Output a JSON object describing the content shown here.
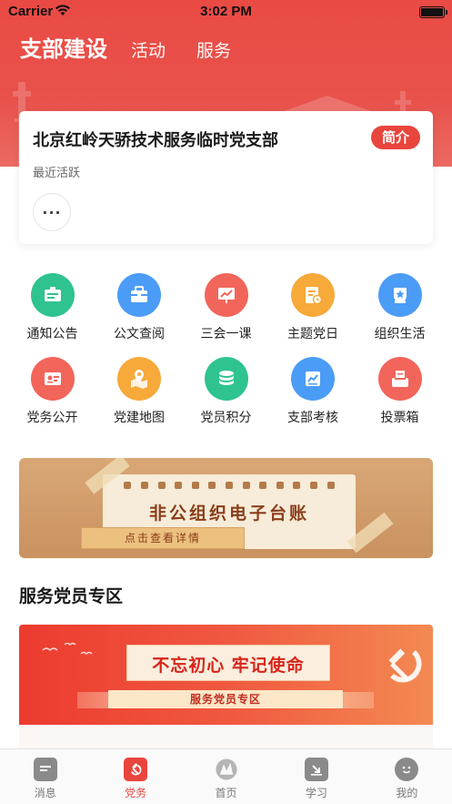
{
  "status_bar": {
    "carrier": "Carrier",
    "time": "3:02 PM"
  },
  "header": {
    "tabs": [
      {
        "label": "支部建设",
        "active": true
      },
      {
        "label": "活动",
        "active": false
      },
      {
        "label": "服务",
        "active": false
      }
    ]
  },
  "branch_card": {
    "name": "北京红岭天骄技术服务临时党支部",
    "intro_label": "简介",
    "recent_label": "最近活跃",
    "more_label": "···"
  },
  "grid": {
    "items": [
      {
        "label": "通知公告",
        "icon": "notice-board-icon",
        "color": "#2fc38f"
      },
      {
        "label": "公文查阅",
        "icon": "briefcase-icon",
        "color": "#4b9cf6"
      },
      {
        "label": "三会一课",
        "icon": "presentation-icon",
        "color": "#f2655a"
      },
      {
        "label": "主题党日",
        "icon": "document-clock-icon",
        "color": "#f7a93a"
      },
      {
        "label": "组织生活",
        "icon": "star-badge-icon",
        "color": "#4b9cf6"
      },
      {
        "label": "党务公开",
        "icon": "id-card-icon",
        "color": "#f2655a"
      },
      {
        "label": "党建地图",
        "icon": "map-pin-icon",
        "color": "#f7a93a"
      },
      {
        "label": "党员积分",
        "icon": "coin-stack-icon",
        "color": "#2fc38f"
      },
      {
        "label": "支部考核",
        "icon": "chart-board-icon",
        "color": "#4b9cf6"
      },
      {
        "label": "投票箱",
        "icon": "ballot-box-icon",
        "color": "#f2655a"
      }
    ]
  },
  "ledger_banner": {
    "title": "非公组织电子台账",
    "button_label": "点击查看详情"
  },
  "service_section": {
    "title": "服务党员专区",
    "banner_slogan": "不忘初心 牢记使命",
    "banner_subtitle": "服务党员专区"
  },
  "tabbar": {
    "items": [
      {
        "label": "消息",
        "icon": "message-icon",
        "active": false
      },
      {
        "label": "党务",
        "icon": "party-emblem-icon",
        "active": true
      },
      {
        "label": "首页",
        "icon": "home-logo-icon",
        "active": false
      },
      {
        "label": "学习",
        "icon": "study-icon",
        "active": false
      },
      {
        "label": "我的",
        "icon": "profile-icon",
        "active": false
      }
    ]
  },
  "colors": {
    "primary_red": "#e8453d",
    "text_dark": "#1a1a1a",
    "text_muted": "#666666"
  }
}
